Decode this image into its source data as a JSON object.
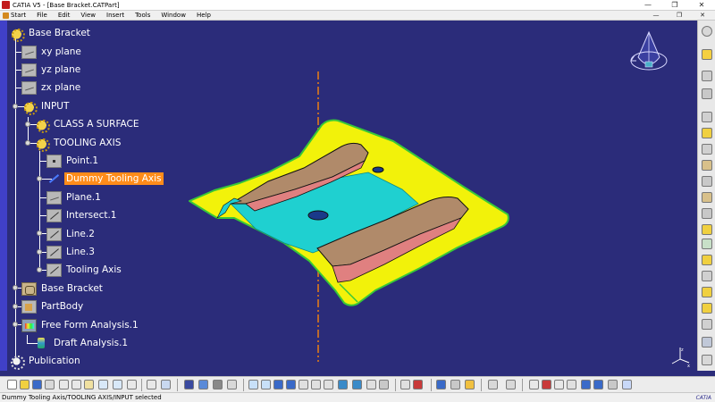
{
  "window": {
    "title": "CATIA V5 - [Base Bracket.CATPart]",
    "controls": {
      "minimize": "—",
      "restore": "❐",
      "close": "✕"
    }
  },
  "menubar": {
    "items": [
      "Start",
      "File",
      "Edit",
      "View",
      "Insert",
      "Tools",
      "Window",
      "Help"
    ],
    "mdi_controls": {
      "minimize": "—",
      "restore": "❐",
      "close": "✕"
    }
  },
  "tree": {
    "nodes": [
      {
        "label": "Base Bracket",
        "icon": "part-gear-icon"
      },
      {
        "label": "xy plane",
        "icon": "plane-icon"
      },
      {
        "label": "yz plane",
        "icon": "plane-icon"
      },
      {
        "label": "zx plane",
        "icon": "plane-icon"
      },
      {
        "label": "INPUT",
        "icon": "geometrical-set-icon"
      },
      {
        "label": "CLASS A SURFACE",
        "icon": "geometrical-set-icon"
      },
      {
        "label": "TOOLING AXIS",
        "icon": "geometrical-set-icon"
      },
      {
        "label": "Point.1",
        "icon": "point-icon"
      },
      {
        "label": "Dummy Tooling Axis",
        "icon": "line-icon",
        "selected": true
      },
      {
        "label": "Plane.1",
        "icon": "plane-icon"
      },
      {
        "label": "Intersect.1",
        "icon": "intersect-icon"
      },
      {
        "label": "Line.2",
        "icon": "line-icon"
      },
      {
        "label": "Line.3",
        "icon": "line-icon"
      },
      {
        "label": "Tooling Axis",
        "icon": "line-icon"
      },
      {
        "label": "Base Bracket",
        "icon": "part-icon"
      },
      {
        "label": "PartBody",
        "icon": "body-icon"
      },
      {
        "label": "Free Form Analysis.1",
        "icon": "analysis-icon"
      },
      {
        "label": "Draft Analysis.1",
        "icon": "draft-analysis-icon"
      },
      {
        "label": "Publication",
        "icon": "publication-icon"
      }
    ]
  },
  "viewport": {
    "background": "#2b2c7a",
    "surface_color": "#f2f20a",
    "flange_color": "#1fd0d0",
    "rib_top_color": "#b08a6a",
    "rib_side_color": "#e08080",
    "axis_color": "#e07a1a",
    "compass_icon": "compass-icon",
    "axis_triad_icon": "axis-triad-icon"
  },
  "status": {
    "text": "Dummy Tooling Axis/TOOLING AXIS/INPUT selected",
    "brand": "CATIA"
  }
}
